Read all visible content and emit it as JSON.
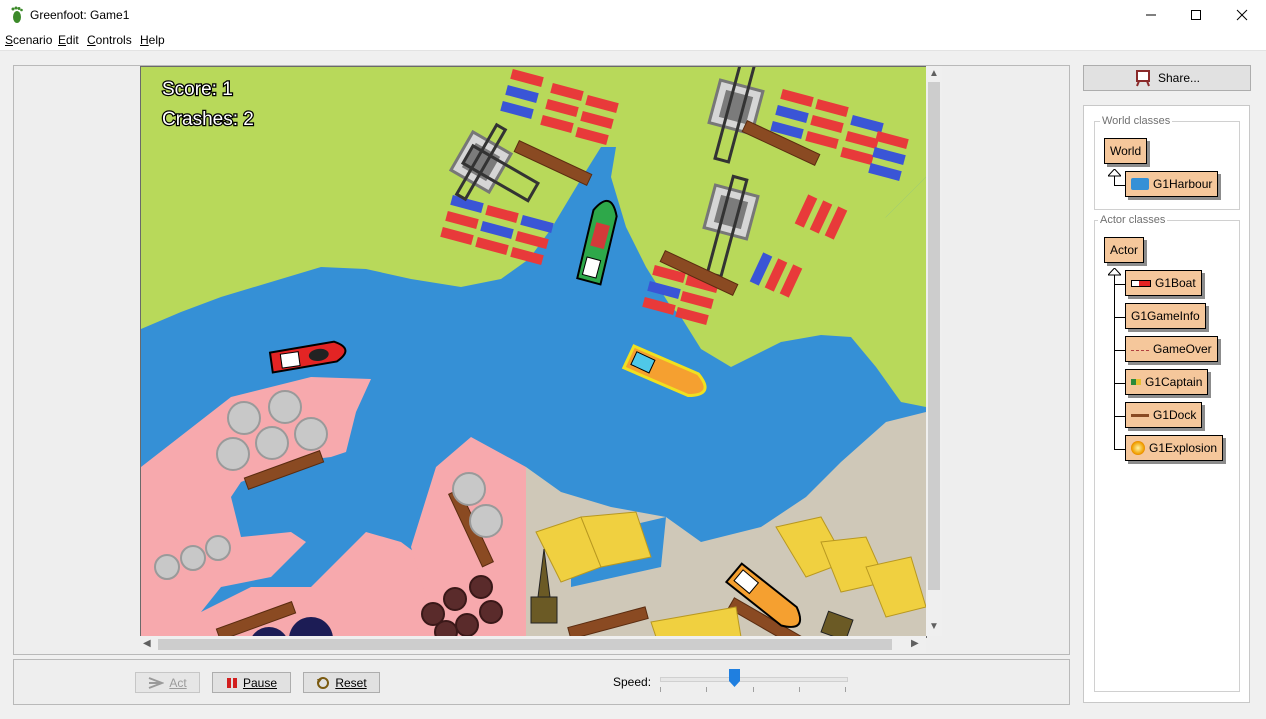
{
  "window": {
    "title": "Greenfoot: Game1"
  },
  "menu": [
    {
      "mnemonic": "S",
      "rest": "cenario"
    },
    {
      "mnemonic": "E",
      "rest": "dit"
    },
    {
      "mnemonic": "C",
      "rest": "ontrols"
    },
    {
      "mnemonic": "H",
      "rest": "elp"
    }
  ],
  "world": {
    "score_text": "Score: 1",
    "crashes_text": "Crashes: 2"
  },
  "controls": {
    "act_label": "Act",
    "pause_label": "Pause",
    "reset_label": "Reset",
    "speed_label": "Speed:",
    "speed_value": 0.4
  },
  "share": {
    "label": "Share..."
  },
  "classes": {
    "world_title": "World classes",
    "world_root": "World",
    "world_items": [
      "G1Harbour"
    ],
    "actor_title": "Actor classes",
    "actor_root": "Actor",
    "actor_items": [
      "G1Boat",
      "G1GameInfo",
      "GameOver",
      "G1Captain",
      "G1Dock",
      "G1Explosion"
    ]
  },
  "colors": {
    "water": "#3590d6",
    "grass": "#b8d95a",
    "pink_land": "#f7a9ad",
    "sand": "#cfc8b8",
    "class_fill": "#f5c79b",
    "slider_thumb": "#1f7fe0"
  },
  "icons": {
    "app": "greenfoot-foot-icon",
    "share": "share-easel-icon",
    "pause": "pause-icon",
    "reset": "reset-icon",
    "act": "act-arrow-icon"
  }
}
